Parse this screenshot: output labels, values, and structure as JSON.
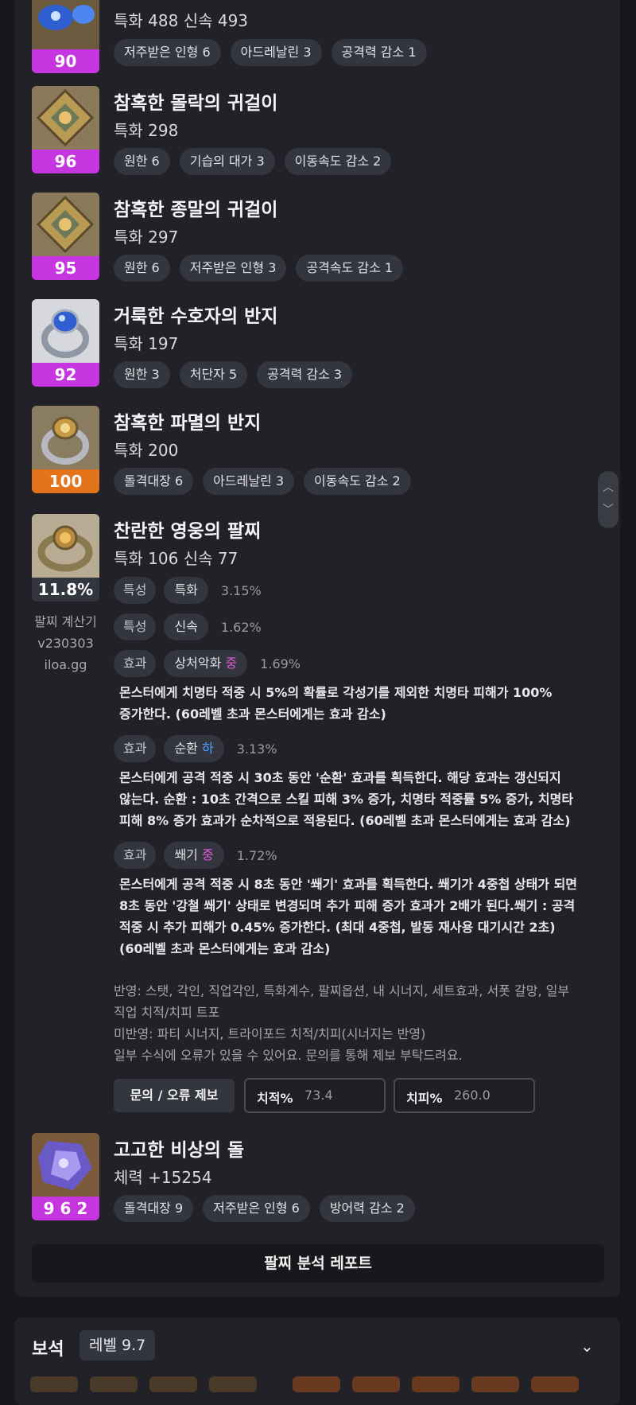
{
  "items": [
    {
      "name": "",
      "stat": "특화 488  신속 493",
      "badge": "90",
      "chips": [
        "저주받은 인형 6",
        "아드레날린 3",
        "공격력 감소 1"
      ]
    },
    {
      "name": "참혹한 몰락의 귀걸이",
      "stat": "특화 298",
      "badge": "96",
      "chips": [
        "원한 6",
        "기습의 대가 3",
        "이동속도 감소 2"
      ]
    },
    {
      "name": "참혹한 종말의 귀걸이",
      "stat": "특화 297",
      "badge": "95",
      "chips": [
        "원한 6",
        "저주받은 인형 3",
        "공격속도 감소 1"
      ]
    },
    {
      "name": "거룩한 수호자의 반지",
      "stat": "특화 197",
      "badge": "92",
      "chips": [
        "원한 3",
        "처단자 5",
        "공격력 감소 3"
      ]
    },
    {
      "name": "참혹한 파멸의 반지",
      "stat": "특화 200",
      "badge": "100",
      "chips": [
        "돌격대장 6",
        "아드레날린 3",
        "이동속도 감소 2"
      ]
    }
  ],
  "bracelet": {
    "name": "찬란한 영웅의 팔찌",
    "stat": "특화 106  신속 77",
    "badge": "11.8%",
    "side_lines": [
      "팔찌 계산기",
      "v230303",
      "iloa.gg"
    ],
    "options": [
      {
        "type": "특성",
        "label": "특화",
        "grade": "",
        "pct": "3.15%"
      },
      {
        "type": "특성",
        "label": "신속",
        "grade": "",
        "pct": "1.62%"
      },
      {
        "type": "효과",
        "label": "상처악화",
        "grade": "중",
        "pct": "1.69%",
        "desc": [
          "몬스터에게 치명타 적중 시 5%의 확률로 각성기를 제외한 치명타 피해가 100%",
          "증가한다. (60레벨 초과 몬스터에게는 효과 감소)"
        ]
      },
      {
        "type": "효과",
        "label": "순환",
        "grade": "하",
        "pct": "3.13%",
        "desc": [
          "몬스터에게 공격 적중 시 30초 동안 '순환' 효과를 획득한다. 해당 효과는 갱신되지",
          "않는다. 순환 : 10초 간격으로 스킬 피해 3% 증가, 치명타 적중률 5% 증가, 치명타",
          "피해 8% 증가 효과가 순차적으로 적용된다. (60레벨 초과 몬스터에게는 효과 감소)"
        ]
      },
      {
        "type": "효과",
        "label": "쐐기",
        "grade": "중",
        "pct": "1.72%",
        "desc": [
          "몬스터에게 공격 적중 시 8초 동안 '쐐기' 효과를 획득한다. 쐐기가 4중첩 상태가 되면",
          "8초 동안 '강철 쐐기' 상태로 변경되며 추가 피해 증가 효과가 2배가 된다.쐐기 : 공격",
          "적중 시 추가 피해가 0.45% 증가한다. (최대 4중첩, 발동 재사용 대기시간 2초)",
          "(60레벨 초과 몬스터에게는 효과 감소)"
        ]
      }
    ],
    "notes": [
      "반영: 스탯, 각인, 직업각인, 특화계수, 팔찌옵션, 내 시너지, 세트효과, 서폿 갈망, 일부",
      "직업 치적/치피 트포",
      "미반영: 파티 시너지, 트라이포드 치적/치피(시너지는 반영)",
      "일부 수식에 오류가 있을 수 있어요. 문의를 통해 제보 부탁드려요."
    ],
    "report_button": "문의 / 오류 제보",
    "crit_rate_label": "치적%",
    "crit_rate_value": "73.4",
    "crit_dmg_label": "치피%",
    "crit_dmg_value": "260.0"
  },
  "stone": {
    "name": "고고한 비상의 돌",
    "stat": "체력 +15254",
    "badge": "9 6 2",
    "chips": [
      "돌격대장 9",
      "저주받은 인형 6",
      "방어력 감소 2"
    ]
  },
  "analysis_button": "팔찌 분석 레포트",
  "gems": {
    "title": "보석",
    "level": "레벨 9.7"
  },
  "colors": {
    "badge_purple": "#c636e0",
    "badge_orange": "#e3741c",
    "grade_mid": "#e05ad9",
    "grade_low": "#4fa0ff"
  },
  "icons": [
    "chevron-up-icon",
    "chevron-down-icon"
  ]
}
